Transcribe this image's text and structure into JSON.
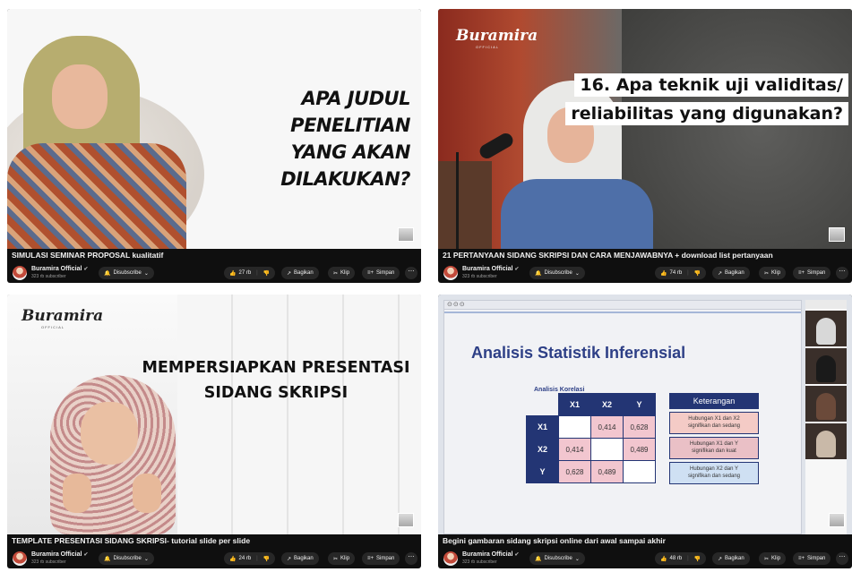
{
  "videos": [
    {
      "title": "SIMULASI SEMINAR PROPOSAL kualitatif",
      "overlay_lines": [
        "APA JUDUL PENELITIAN",
        "YANG AKAN DILAKUKAN?"
      ],
      "channel": "Buramira Official",
      "subscribers": "323 rb subscriber",
      "subscribe_label": "Disubscribe",
      "likes": "27 rb",
      "share_label": "Bagikan",
      "clip_label": "Klip",
      "save_label": "Simpan"
    },
    {
      "title": "21 PERTANYAAN SIDANG SKRIPSI DAN CARA MENJAWABNYA + download list pertanyaan",
      "overlay_lines": [
        "16. Apa teknik uji validitas/",
        "reliabilitas yang digunakan?"
      ],
      "logo": "Buramira",
      "logo_sub": "OFFICIAL",
      "channel": "Buramira Official",
      "subscribers": "323 rb subscriber",
      "subscribe_label": "Disubscribe",
      "likes": "74 rb",
      "share_label": "Bagikan",
      "clip_label": "Klip",
      "save_label": "Simpan"
    },
    {
      "title": "TEMPLATE PRESENTASI SIDANG SKRIPSI- tutorial slide per slide",
      "overlay_lines": [
        "MEMPERSIAPKAN PRESENTASI",
        "SIDANG SKRIPSI"
      ],
      "logo": "Buramira",
      "logo_sub": "OFFICIAL",
      "channel": "Buramira Official",
      "subscribers": "323 rb subscriber",
      "subscribe_label": "Disubscribe",
      "likes": "24 rb",
      "share_label": "Bagikan",
      "clip_label": "Klip",
      "save_label": "Simpan"
    },
    {
      "title": "Begini gambaran sidang skripsi online dari awal sampai akhir",
      "slide_title": "Analisis Statistik Inferensial",
      "slide_subtitle": "Analisis Korelasi",
      "table_header": [
        "",
        "X1",
        "X2",
        "Y"
      ],
      "table_rows": [
        [
          "X1",
          "",
          "0,414",
          "0,628"
        ],
        [
          "X2",
          "0,414",
          "",
          "0,489"
        ],
        [
          "Y",
          "0,628",
          "0,489",
          ""
        ]
      ],
      "notes_header": "Keterangan",
      "notes": [
        {
          "line1": "Hubungan X1 dan X2",
          "line2": "signifikan dan sedang"
        },
        {
          "line1": "Hubungan X1 dan Y",
          "line2": "signifikan dan kuat"
        },
        {
          "line1": "Hubungan X2 dan Y",
          "line2": "signifikan dan sedang"
        }
      ],
      "channel": "Buramira Official",
      "subscribers": "323 rb subscriber",
      "subscribe_label": "Disubscribe",
      "likes": "48 rb",
      "share_label": "Bagikan",
      "clip_label": "Klip",
      "save_label": "Simpan"
    }
  ],
  "icons": {
    "verified": "✔",
    "bell": "🔔",
    "chevron": "⌄",
    "like": "👍",
    "dislike": "👎",
    "share": "↗",
    "clip": "✂",
    "save": "≡+",
    "more": "⋯",
    "window_dots": "⊙⊙⊙"
  },
  "colors": {
    "card_bg": "#0f0f0f",
    "pill_bg": "#272727",
    "slide_blue": "#233574",
    "highlight_pink": "#f2c6cf"
  }
}
